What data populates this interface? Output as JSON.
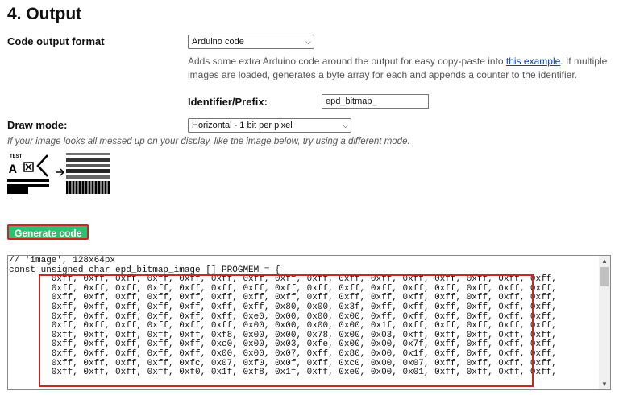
{
  "section": {
    "title": "4. Output"
  },
  "output_format": {
    "label": "Code output format",
    "selected": "Arduino code",
    "desc_before": "Adds some extra Arduino code around the output for easy copy-paste into ",
    "link": "this example",
    "desc_after": ". If multiple images are loaded, generates a byte array for each and appends a counter to the identifier."
  },
  "identifier": {
    "label": "Identifier/Prefix:",
    "value": "epd_bitmap_"
  },
  "draw_mode": {
    "label": "Draw mode:",
    "selected": "Horizontal - 1 bit per pixel",
    "note": "If your image looks all messed up on your display, like the image below, try using a different mode."
  },
  "generate": {
    "label": "Generate code"
  },
  "code": {
    "lines": [
      "// 'image', 128x64px",
      "const unsigned char epd_bitmap_image [] PROGMEM = {",
      "        0xff, 0xff, 0xff, 0xff, 0xff, 0xff, 0xff, 0xff, 0xff, 0xff, 0xff, 0xff, 0xff, 0xff, 0xff, 0xff,",
      "        0xff, 0xff, 0xff, 0xff, 0xff, 0xff, 0xff, 0xff, 0xff, 0xff, 0xff, 0xff, 0xff, 0xff, 0xff, 0xff,",
      "        0xff, 0xff, 0xff, 0xff, 0xff, 0xff, 0xff, 0xff, 0xff, 0xff, 0xff, 0xff, 0xff, 0xff, 0xff, 0xff,",
      "        0xff, 0xff, 0xff, 0xff, 0xff, 0xff, 0xff, 0x80, 0x00, 0x3f, 0xff, 0xff, 0xff, 0xff, 0xff, 0xff,",
      "        0xff, 0xff, 0xff, 0xff, 0xff, 0xff, 0xe0, 0x00, 0x00, 0x00, 0xff, 0xff, 0xff, 0xff, 0xff, 0xff,",
      "        0xff, 0xff, 0xff, 0xff, 0xff, 0xff, 0x00, 0x00, 0x00, 0x00, 0x1f, 0xff, 0xff, 0xff, 0xff, 0xff,",
      "        0xff, 0xff, 0xff, 0xff, 0xff, 0xf8, 0x00, 0x00, 0x78, 0x00, 0x03, 0xff, 0xff, 0xff, 0xff, 0xff,",
      "        0xff, 0xff, 0xff, 0xff, 0xff, 0xc0, 0x00, 0x03, 0xfe, 0x00, 0x00, 0x7f, 0xff, 0xff, 0xff, 0xff,",
      "        0xff, 0xff, 0xff, 0xff, 0xff, 0x00, 0x00, 0x07, 0xff, 0x80, 0x00, 0x1f, 0xff, 0xff, 0xff, 0xff,",
      "        0xff, 0xff, 0xff, 0xff, 0xfc, 0x07, 0xf0, 0x0f, 0xff, 0xc0, 0x00, 0x07, 0xff, 0xff, 0xff, 0xff,",
      "        0xff, 0xff, 0xff, 0xff, 0xf0, 0x1f, 0xf8, 0x1f, 0xff, 0xe0, 0x00, 0x01, 0xff, 0xff, 0xff, 0xff,"
    ]
  },
  "icons": {
    "example": "mode-example-image",
    "arrow": "arrow-right-icon",
    "chevron": "chevron-down-icon"
  },
  "colors": {
    "button": "#2fbf71",
    "highlight": "#c62828",
    "link": "#0645ad"
  }
}
